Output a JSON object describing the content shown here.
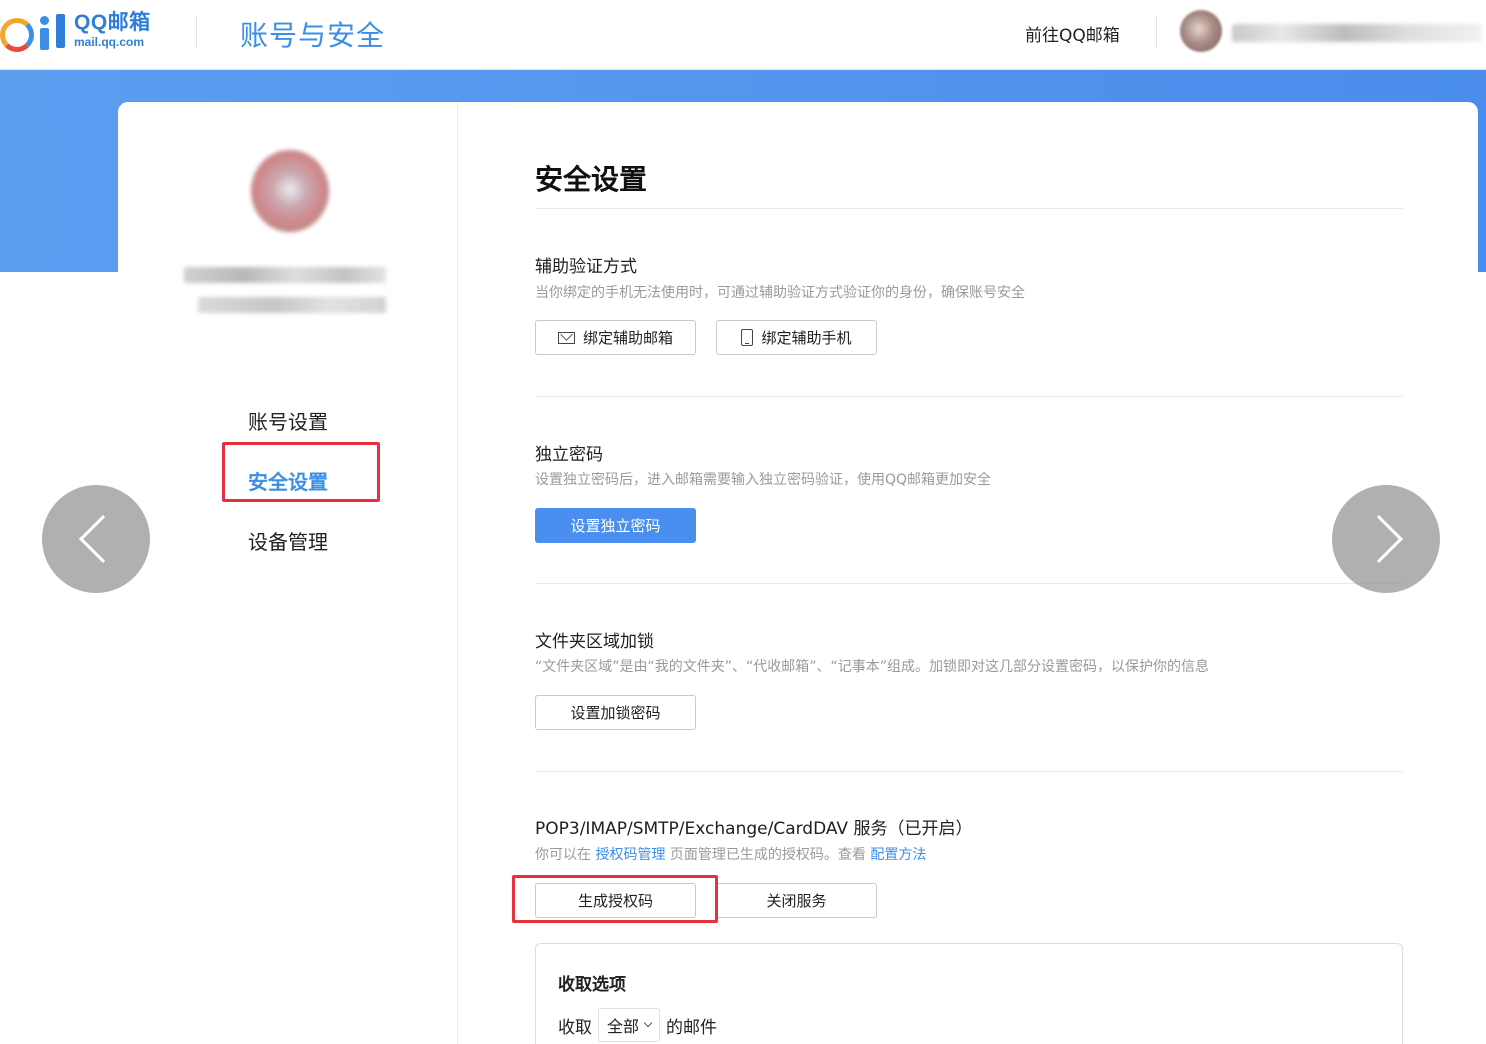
{
  "header": {
    "logo_text": "QQ邮箱",
    "logo_domain": "mail.qq.com",
    "title": "账号与安全",
    "goto_link": "前往QQ邮箱"
  },
  "sidebar": {
    "items": [
      {
        "label": "账号设置"
      },
      {
        "label": "安全设置"
      },
      {
        "label": "设备管理"
      }
    ]
  },
  "main": {
    "page_title": "安全设置",
    "sections": [
      {
        "title": "辅助验证方式",
        "desc": "当你绑定的手机无法使用时，可通过辅助验证方式验证你的身份，确保账号安全",
        "buttons": [
          "绑定辅助邮箱",
          "绑定辅助手机"
        ]
      },
      {
        "title": "独立密码",
        "desc": "设置独立密码后，进入邮箱需要输入独立密码验证，使用QQ邮箱更加安全",
        "buttons": [
          "设置独立密码"
        ]
      },
      {
        "title": "文件夹区域加锁",
        "desc": "“文件夹区域”是由“我的文件夹”、“代收邮箱”、“记事本”组成。加锁即对这几部分设置密码，以保护你的信息",
        "buttons": [
          "设置加锁密码"
        ]
      },
      {
        "title": "POP3/IMAP/SMTP/Exchange/CardDAV 服务（已开启）",
        "desc_prefix": "你可以在",
        "desc_link1": "授权码管理",
        "desc_mid": "页面管理已生成的授权码。查看",
        "desc_link2": "配置方法",
        "buttons": [
          "生成授权码",
          "关闭服务"
        ]
      }
    ],
    "receive_options": {
      "title": "收取选项",
      "prefix": "收取",
      "select_value": "全部",
      "suffix": "的邮件"
    }
  },
  "icons": {
    "mail": "mail-icon",
    "phone": "phone-icon",
    "prev": "chevron-left-icon",
    "next": "chevron-right-icon"
  },
  "colors": {
    "accent": "#3b8fe6",
    "primary_button": "#4a8ff0",
    "highlight": "#e5323e"
  }
}
